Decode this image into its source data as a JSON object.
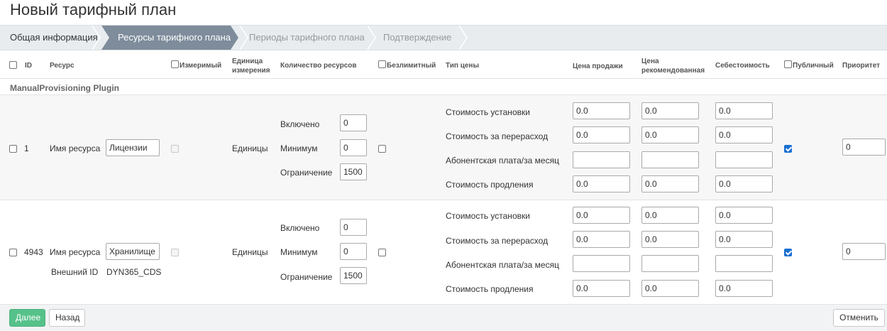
{
  "page": {
    "title": "Новый тарифный план"
  },
  "wizard": {
    "steps": [
      {
        "label": "Общая информация",
        "state": "done"
      },
      {
        "label": "Ресурсы тарифного плана",
        "state": "active"
      },
      {
        "label": "Периоды тарифного плана",
        "state": "pending"
      },
      {
        "label": "Подтверждение",
        "state": "pending"
      }
    ],
    "active_color": "#7e8c9b"
  },
  "table": {
    "headers": {
      "id": "ID",
      "resource": "Ресурс",
      "measurable": "Измеримый",
      "unit": "Единица измерения",
      "unit_l1": "Единица",
      "unit_l2": "измерения",
      "quantity": "Количество ресурсов",
      "unlimited": "Безлимитный",
      "price_type": "Тип цены",
      "sale_price": "Цена продажи",
      "recommended_l1": "Цена",
      "recommended_l2": "рекомендованная",
      "cost": "Себестоимость",
      "public": "Публичный",
      "priority": "Приоритет"
    },
    "group": "ManualProvisioning Plugin",
    "rows": [
      {
        "id": "1",
        "resource_name_label": "Имя ресурса",
        "resource_name": "Лицензии",
        "unit": "Единицы",
        "included_label": "Включено",
        "included": "0",
        "minimum_label": "Минимум",
        "minimum": "0",
        "limit_label": "Ограничение",
        "limit": "1500",
        "public_checked": true,
        "priority": "0",
        "prices": [
          {
            "type": "Стоимость установки",
            "sale": "0.0",
            "recommended": "0.0",
            "cost": "0.0"
          },
          {
            "type": "Стоимость за перерасход",
            "sale": "0.0",
            "recommended": "0.0",
            "cost": "0.0"
          },
          {
            "type": "Абонентская плата/за месяц",
            "sale": "",
            "recommended": "",
            "cost": ""
          },
          {
            "type": "Стоимость продления",
            "sale": "0.0",
            "recommended": "0.0",
            "cost": "0.0"
          }
        ]
      },
      {
        "id": "4943",
        "resource_name_label": "Имя ресурса",
        "resource_name": "Хранилище",
        "external_id_label": "Внешний ID",
        "external_id": "DYN365_CDS",
        "unit": "Единицы",
        "included_label": "Включено",
        "included": "0",
        "minimum_label": "Минимум",
        "minimum": "0",
        "limit_label": "Ограничение",
        "limit": "1500",
        "public_checked": true,
        "priority": "0",
        "prices": [
          {
            "type": "Стоимость установки",
            "sale": "0.0",
            "recommended": "0.0",
            "cost": "0.0"
          },
          {
            "type": "Стоимость за перерасход",
            "sale": "0.0",
            "recommended": "0.0",
            "cost": "0.0"
          },
          {
            "type": "Абонентская плата/за месяц",
            "sale": "",
            "recommended": "",
            "cost": ""
          },
          {
            "type": "Стоимость продления",
            "sale": "0.0",
            "recommended": "0.0",
            "cost": "0.0"
          }
        ]
      }
    ]
  },
  "footer": {
    "next_label": "Далее",
    "back_label": "Назад",
    "cancel_label": "Отменить",
    "next_color": "#56c28a"
  }
}
